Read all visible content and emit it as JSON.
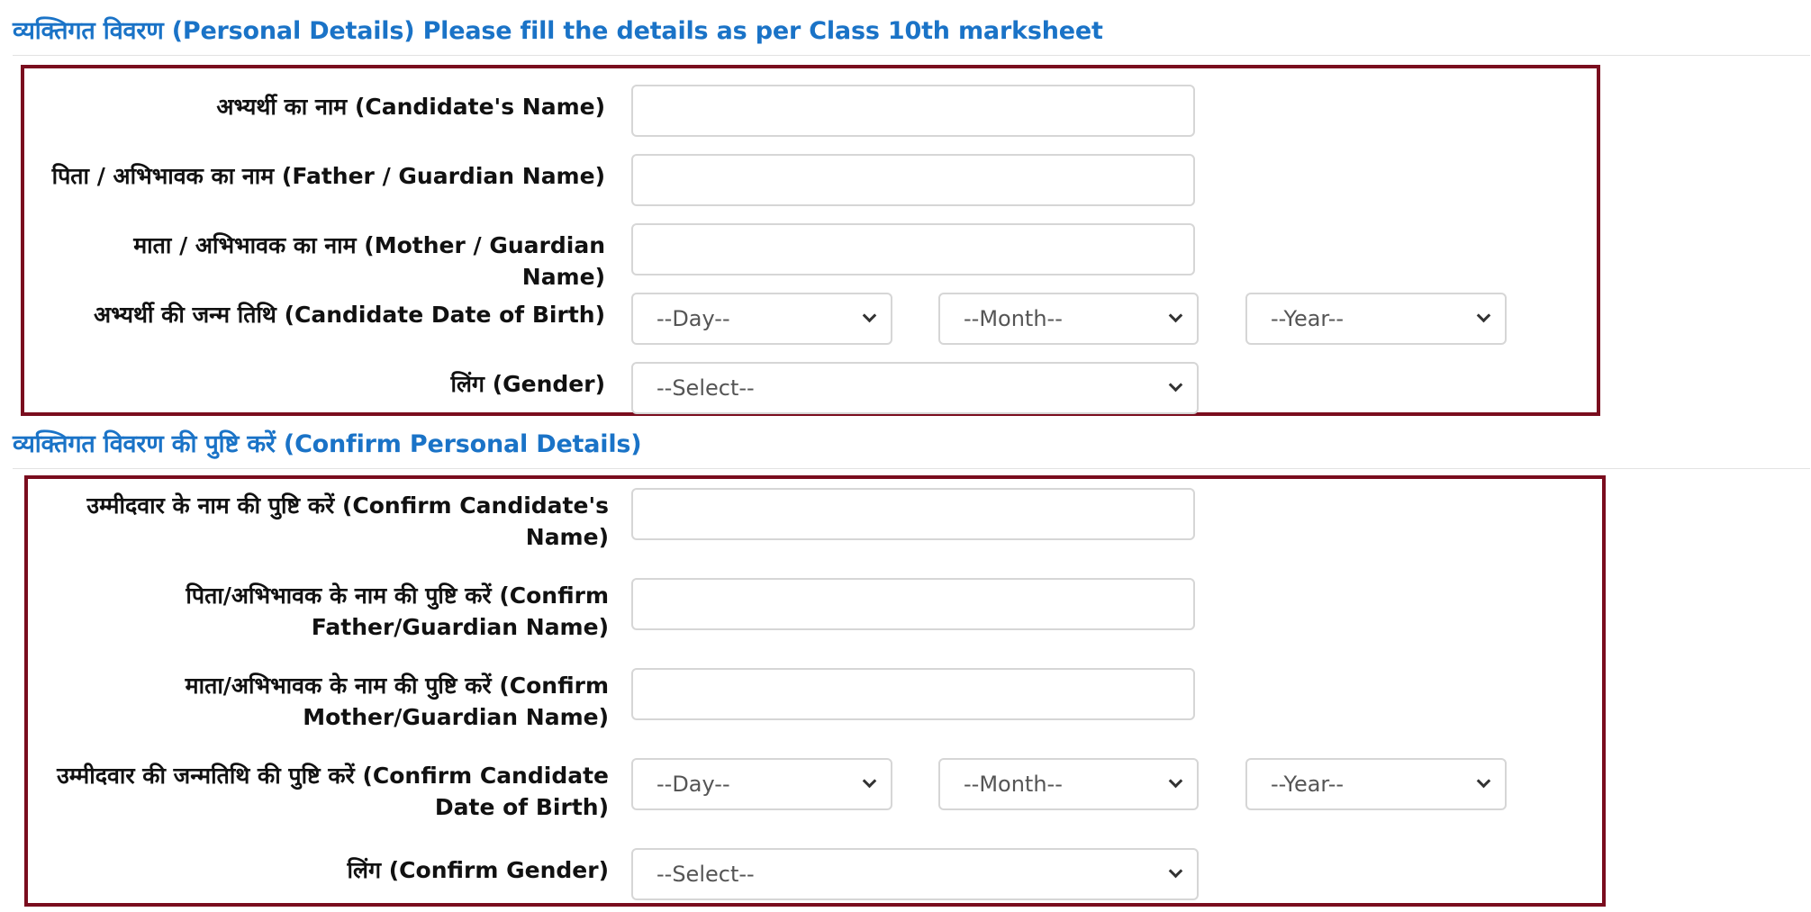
{
  "personal": {
    "title": "व्यक्तिगत विवरण (Personal Details) Please fill the details as per Class 10th marksheet",
    "name_label": "अभ्यर्थी का नाम (Candidate's Name)",
    "father_label": "पिता / अभिभावक का नाम (Father / Guardian Name)",
    "mother_label": "माता / अभिभावक का नाम (Mother / Guardian Name)",
    "dob_label": "अभ्यर्थी की जन्म तिथि (Candidate Date of Birth)",
    "gender_label": "लिंग (Gender)",
    "name_value": "",
    "father_value": "",
    "mother_value": "",
    "day_selected": "--Day--",
    "month_selected": "--Month--",
    "year_selected": "--Year--",
    "gender_selected": "--Select--"
  },
  "confirm": {
    "title": "व्यक्तिगत विवरण की पुष्टि करें (Confirm Personal Details)",
    "name_label": "उम्मीदवार के नाम की पुष्टि करें (Confirm Candidate's Name)",
    "father_label": "पिता/अभिभावक के नाम की पुष्टि करें (Confirm Father/Guardian Name)",
    "mother_label": "माता/अभिभावक के नाम की पुष्टि करें (Confirm Mother/Guardian Name)",
    "dob_label": "उम्मीदवार की जन्मतिथि की पुष्टि करें (Confirm Candidate Date of Birth)",
    "gender_label": "लिंग (Confirm Gender)",
    "name_value": "",
    "father_value": "",
    "mother_value": "",
    "day_selected": "--Day--",
    "month_selected": "--Month--",
    "year_selected": "--Year--",
    "gender_selected": "--Select--"
  },
  "colors": {
    "title": "#1a73c7",
    "panel_border": "#7a0d1e",
    "input_border": "#d6d6d6"
  },
  "icons": {
    "select_arrow": "chevron-down-icon"
  }
}
